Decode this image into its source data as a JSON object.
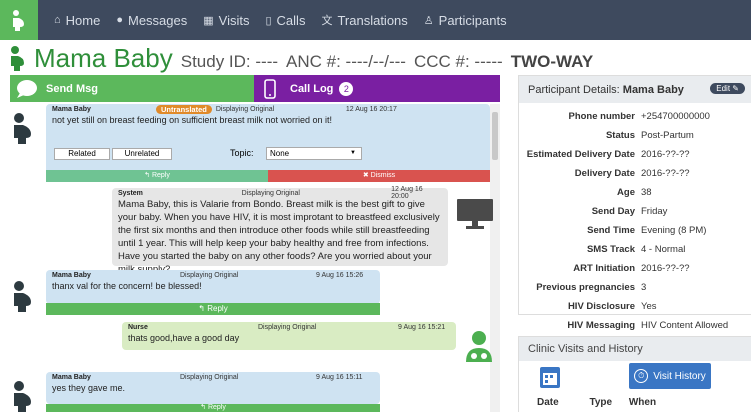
{
  "nav": {
    "items": [
      {
        "label": "Home",
        "icon": "home-icon"
      },
      {
        "label": "Messages",
        "icon": "chat-icon"
      },
      {
        "label": "Visits",
        "icon": "calendar-icon"
      },
      {
        "label": "Calls",
        "icon": "phone-icon"
      },
      {
        "label": "Translations",
        "icon": "translate-icon"
      },
      {
        "label": "Participants",
        "icon": "users-icon"
      }
    ]
  },
  "header": {
    "name": "Mama Baby",
    "study_id": "Study ID: ----",
    "anc": "ANC #: ----/--/---",
    "ccc": "CCC #: -----",
    "mode": "TWO-WAY"
  },
  "tabs": {
    "send_msg": "Send Msg",
    "call_log": "Call Log",
    "call_count": "2"
  },
  "messages": [
    {
      "sender": "Mama Baby",
      "status": "Untranslated",
      "display": "Displaying Original",
      "time": "12 Aug 16 20:17",
      "text": "not yet still on breast feeding on sufficient breast milk not worried on it!",
      "related": "Related",
      "unrelated": "Unrelated",
      "topic_label": "Topic:",
      "topic_value": "None",
      "reply": "Reply",
      "dismiss": "Dismiss"
    },
    {
      "sender": "System",
      "display": "Displaying Original",
      "time": "12 Aug 16 20:00",
      "text": "Mama Baby, this is Valarie from Bondo. Breast milk is the best gift to give your baby. When you have HIV, it is most improtant to breastfeed exclusively the first six months and then introduce other foods while still breastfeeding until 1 year. This will help keep your baby healthy and free from infections. Have you started the baby on any other foods? Are you worried about your milk supply?"
    },
    {
      "sender": "Mama Baby",
      "display": "Displaying Original",
      "time": "9 Aug 16 15:26",
      "text": "thanx val for the concern! be blessed!",
      "reply": "Reply"
    },
    {
      "sender": "Nurse",
      "display": "Displaying Original",
      "time": "9 Aug 16 15:21",
      "text": "thats good,have a good day"
    },
    {
      "sender": "Mama Baby",
      "display": "Displaying Original",
      "time": "9 Aug 16 15:11",
      "text": "yes they gave me.",
      "reply": "Reply"
    }
  ],
  "details": {
    "title_prefix": "Participant Details:",
    "title_name": "Mama Baby",
    "edit": "Edit",
    "rows": [
      {
        "key": "Phone number",
        "value": "+254700000000"
      },
      {
        "key": "Status",
        "value": "Post-Partum"
      },
      {
        "key": "Estimated Delivery Date",
        "value": "2016-??-??"
      },
      {
        "key": "Delivery Date",
        "value": "2016-??-??"
      },
      {
        "key": "Age",
        "value": "38"
      },
      {
        "key": "Send Day",
        "value": "Friday"
      },
      {
        "key": "Send Time",
        "value": "Evening (8 PM)"
      },
      {
        "key": "SMS Track",
        "value": "4 - Normal"
      },
      {
        "key": "ART Initiation",
        "value": "2016-??-??"
      },
      {
        "key": "Previous pregnancies",
        "value": "3"
      },
      {
        "key": "HIV Disclosure",
        "value": "Yes"
      },
      {
        "key": "HIV Messaging",
        "value": "HIV Content Allowed"
      }
    ]
  },
  "visits": {
    "title": "Clinic Visits and History",
    "history_button": "Visit History",
    "columns": [
      "Date",
      "Type",
      "When"
    ]
  },
  "colors": {
    "nav_bg": "#3e4a5e",
    "green": "#5cb85c",
    "purple": "#7a1fa2",
    "participant_bubble": "#cfe3f2",
    "system_bubble": "#e6e6e6",
    "nurse_bubble": "#d9ecc3",
    "dismiss": "#d9534f",
    "untranslated": "#e08a2a"
  }
}
